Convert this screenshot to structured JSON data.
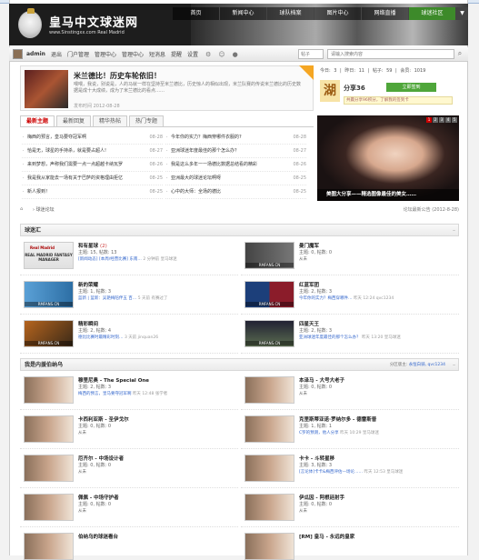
{
  "header": {
    "site_title": "皇马中文球迷网",
    "site_url": "www.Sinstingxx.com Real Madrid",
    "nav": [
      "首页",
      "新闻中心",
      "球队档案",
      "图片中心",
      "网络直播",
      "球迷社区"
    ],
    "nav_dropdown_icon": "chevron-down-icon"
  },
  "userbar": {
    "username": "admin",
    "links": [
      "退出",
      "门户管理",
      "管理中心",
      "管理中心",
      "短消息",
      "提醒",
      "设置"
    ],
    "search_scope": "帖子",
    "search_placeholder": "请输入搜索内容",
    "search_icon": "search-icon"
  },
  "notice": {
    "title": "米兰德比！历史车轮依旧！",
    "text": "喂喂，我说，别说是，人的马就一样在坚持至米兰德比，历史惊人的相似出现，米兰队赛的传说米兰德比的历史数据是成十大成绩，成为了米兰德比的看点……",
    "date": "发布时间 2012-08-28"
  },
  "stats": "今日: 3 | 昨日: 11 | 帖子: 59 | 会员: 1019",
  "checkin": {
    "day": "湖",
    "score": "分享36",
    "button": "立即签到",
    "info": "共赢分享96积分，了解我的签到卡"
  },
  "tabs": [
    "最新主题",
    "最新回复",
    "精华热帖",
    "热门专题"
  ],
  "news": {
    "left": [
      {
        "title": "梅西的预言，皇马要夺冠军啊",
        "date": "08-28"
      },
      {
        "title": "恰是无，球星的手持杀，就是要占超人!",
        "date": "08-27"
      },
      {
        "title": "来到梦想，声称我们需要一点一点超越卡纳瓦罗",
        "date": "08-26"
      },
      {
        "title": "我是我从家能去一场有关于巴萨的资格理由拒亿",
        "date": "08-25"
      },
      {
        "title": "新人报到！",
        "date": "08-25"
      }
    ],
    "right": [
      {
        "title": "今年你的实力？梅西穿哪件衣服的?",
        "date": "08-28"
      },
      {
        "title": "亚洲球迷年度最佳的那个怎么办？",
        "date": "08-27"
      },
      {
        "title": "我是这么多年一一场德比数据总结看的精彩",
        "date": "08-26"
      },
      {
        "title": "亚洲最大的球迷论坛啊呀",
        "date": "08-25"
      },
      {
        "title": "心中的大师：全场的德比",
        "date": "08-25"
      }
    ]
  },
  "photo": {
    "caption": "美图大分享——精选图像最佳的美女……",
    "pages": [
      "1",
      "2",
      "3",
      "4",
      "5"
    ]
  },
  "breadcrumb": {
    "home_icon": "home-icon",
    "path": "› 球迷论坛",
    "right": "论坛最新公告 (2012-8-28)"
  },
  "section1": {
    "title": "球迷汇",
    "forums": [
      {
        "thumb": "REAL MADRID FANTASY MANAGER",
        "title": "和有星球",
        "new": "(2)",
        "meta": "主题: 15, 帖数: 13",
        "last": "[新闻动态] [本周/经营比赛] 东南…",
        "last_time": "2 分钟前 皇马球迷"
      },
      {
        "thumb": "RMFANS.CN",
        "title": "曼门魔军",
        "new": "",
        "meta": "主题: 0, 帖数: 0",
        "last": "从未",
        "last_time": ""
      },
      {
        "thumb": "RMFANS.CN",
        "title": "新的荣耀",
        "new": "",
        "meta": "主题: 1, 帖数: 3",
        "last": "蓝新 | 蓝新：吴艳梅陪伴五 百…",
        "last_time": "5 天前 有赛过了"
      },
      {
        "thumb": "RMFANS.CN",
        "title": "红蓝军团",
        "new": "",
        "meta": "主题: 2, 帖数: 3",
        "last": "今年你的实力？梅西穿哪件…",
        "last_time": "昨天 12:24 qvc1234"
      },
      {
        "thumb": "RMFANS.CN",
        "title": "精彩瞬间",
        "new": "",
        "meta": "主题: 2, 帖数: 4",
        "last": "德比比赛时最精彩时刻…",
        "last_time": "3 天前 jinquan26"
      },
      {
        "thumb": "RMFANS.CN",
        "title": "四星天王",
        "new": "",
        "meta": "主题: 2, 帖数: 3",
        "last": "亚洲球迷年度最佳的那个怎么办？",
        "last_time": "昨天 13:20 皇马球迷"
      }
    ]
  },
  "section2": {
    "title": "我是内援伯纳乌",
    "mods_label": "分区版主:",
    "mods": "永恒白骑, qvc1234",
    "forums": [
      {
        "title": "穆里尼奥 - The Special One",
        "meta": "主题: 2, 帖数: 3",
        "last": "梅西的预言，皇马要夺冠军啊",
        "last_time": "昨天 12:48 张学者"
      },
      {
        "title": "本泽马 - 大号大老子",
        "meta": "主题: 0, 帖数: 0",
        "last": "从未",
        "last_time": ""
      },
      {
        "title": "卡西利亚斯 - 圣伊戈尔",
        "meta": "主题: 0, 帖数: 0",
        "last": "从未",
        "last_time": ""
      },
      {
        "title": "克里斯蒂亚诺·罗纳尔多 - 德雷斯普",
        "meta": "主题: 1, 帖数: 1",
        "last": "C罗的预测，他人分享",
        "last_time": "昨天 10:29 皇马球迷"
      },
      {
        "title": "厄齐尔 - 中场设计者",
        "meta": "主题: 0, 帖数: 0",
        "last": "从未",
        "last_time": ""
      },
      {
        "title": "卡卡 - 斗转星移",
        "meta": "主题: 3, 帖数: 3",
        "last": "[言论体]卡卡&梅西评估—场论……",
        "last_time": "昨天 12:53 皇马球迷"
      },
      {
        "title": "佩佩 - 中场守护者",
        "meta": "主题: 0, 帖数: 0",
        "last": "从未",
        "last_time": ""
      },
      {
        "title": "伊瓜因 - 阿根廷射手",
        "meta": "主题: 0, 帖数: 0",
        "last": "从未",
        "last_time": ""
      },
      {
        "title": "伯纳乌的球迷看台",
        "meta": "",
        "last": "",
        "last_time": ""
      },
      {
        "title": "[RM] 皇马 - 永远的皇家",
        "meta": "",
        "last": "",
        "last_time": ""
      }
    ]
  }
}
